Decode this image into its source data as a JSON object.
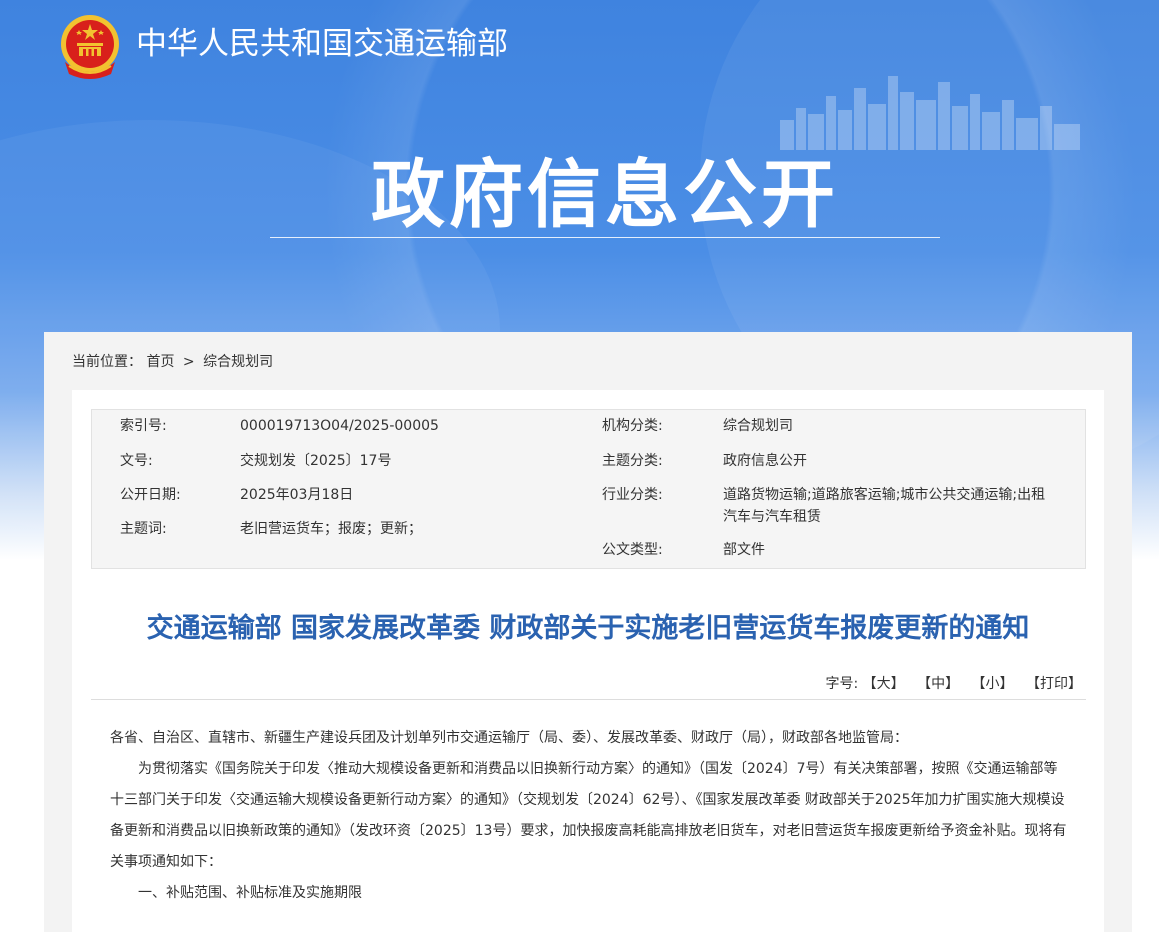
{
  "header": {
    "site_title": "中华人民共和国交通运输部",
    "banner_title": "政府信息公开",
    "emblem_icon": "national-emblem-icon"
  },
  "breadcrumb": {
    "label": "当前位置：",
    "items": [
      "首页",
      "综合规划司"
    ],
    "separator": ">"
  },
  "meta": {
    "index_no_label": "索引号:",
    "index_no": "000019713O04/2025-00005",
    "org_label": "机构分类:",
    "org": "综合规划司",
    "doc_no_label": "文号:",
    "doc_no": "交规划发〔2025〕17号",
    "topic_label": "主题分类:",
    "topic": "政府信息公开",
    "date_label": "公开日期:",
    "date": "2025年03月18日",
    "industry_label": "行业分类:",
    "industry": "道路货物运输;道路旅客运输;城市公共交通运输;出租汽车与汽车租赁",
    "keywords_label": "主题词:",
    "keywords": "老旧营运货车；报废；更新；",
    "doc_type_label": "公文类型:",
    "doc_type": "部文件"
  },
  "document": {
    "title": "交通运输部 国家发展改革委 财政部关于实施老旧营运货车报废更新的通知",
    "font_size_label": "字号:",
    "font_large": "【大】",
    "font_medium": "【中】",
    "font_small": "【小】",
    "print": "【打印】",
    "salutation": "各省、自治区、直辖市、新疆生产建设兵团及计划单列市交通运输厅（局、委）、发展改革委、财政厅（局），财政部各地监管局：",
    "paragraph1": "为贯彻落实《国务院关于印发〈推动大规模设备更新和消费品以旧换新行动方案〉的通知》（国发〔2024〕7号）有关决策部署，按照《交通运输部等十三部门关于印发〈交通运输大规模设备更新行动方案〉的通知》（交规划发〔2024〕62号）、《国家发展改革委 财政部关于2025年加力扩围实施大规模设备更新和消费品以旧换新政策的通知》（发改环资〔2025〕13号）要求，加快报废高耗能高排放老旧货车，对老旧营运货车报废更新给予资金补贴。现将有关事项通知如下：",
    "section1": "一、补贴范围、补贴标准及实施期限"
  },
  "colors": {
    "banner_blue": "#4b8ee6",
    "title_blue": "#2a62b0",
    "emblem_red": "#d8201b",
    "emblem_gold": "#f2c230"
  }
}
